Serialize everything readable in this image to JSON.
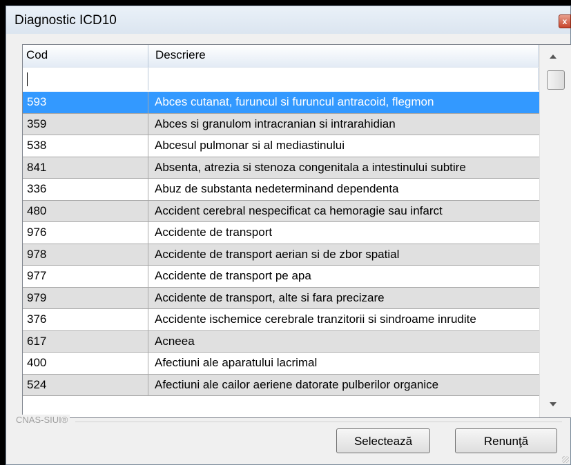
{
  "window": {
    "title": "Diagnostic ICD10",
    "close_label": "x"
  },
  "table": {
    "headers": {
      "code": "Cod",
      "description": "Descriere"
    },
    "filter": {
      "code_value": "",
      "description_value": ""
    },
    "rows": [
      {
        "code": "593",
        "description": "Abces cutanat, furuncul si furuncul antracoid, flegmon",
        "selected": true
      },
      {
        "code": "359",
        "description": "Abces si granulom intracranian si intrarahidian"
      },
      {
        "code": "538",
        "description": "Abcesul pulmonar si al mediastinului"
      },
      {
        "code": "841",
        "description": "Absenta, atrezia si stenoza congenitala a intestinului subtire"
      },
      {
        "code": "336",
        "description": "Abuz de substanta nedeterminand dependenta"
      },
      {
        "code": "480",
        "description": "Accident cerebral nespecificat ca hemoragie sau infarct"
      },
      {
        "code": "976",
        "description": "Accidente de transport"
      },
      {
        "code": "978",
        "description": "Accidente de transport aerian si de zbor spatial"
      },
      {
        "code": "977",
        "description": "Accidente de transport pe apa"
      },
      {
        "code": "979",
        "description": "Accidente de transport, alte si fara precizare"
      },
      {
        "code": "376",
        "description": "Accidente ischemice cerebrale tranzitorii si sindroame inrudite"
      },
      {
        "code": "617",
        "description": "Acneea"
      },
      {
        "code": "400",
        "description": "Afectiuni ale aparatului lacrimal"
      },
      {
        "code": "524",
        "description": "Afectiuni ale cailor aeriene datorate pulberilor organice"
      }
    ]
  },
  "footer": {
    "group_label": "CNAS-SIUI®",
    "select_button": "Selectează",
    "cancel_button": "Renunţă"
  },
  "colors": {
    "selection": "#3399ff",
    "alt_row": "#e0e0e0"
  }
}
